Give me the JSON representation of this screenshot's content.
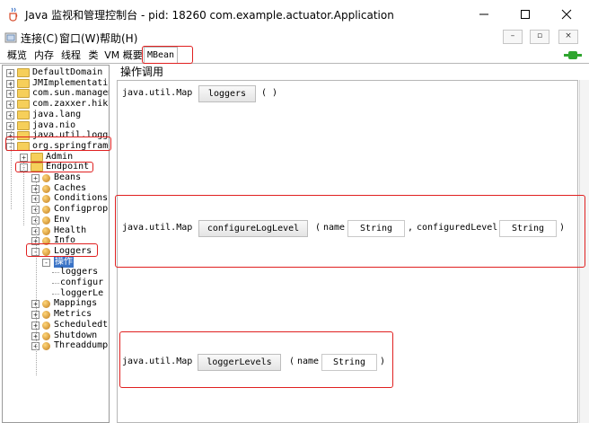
{
  "window": {
    "title": "Java 监视和管理控制台 - pid: 18260 com.example.actuator.Application",
    "minimize_glyph": "–",
    "maximize_glyph": "□",
    "close_glyph": "✕"
  },
  "menubar": {
    "items": [
      "连接(C)",
      "窗口(W)",
      "帮助(H)"
    ],
    "inner_buttons": [
      "–",
      "▫",
      "×"
    ]
  },
  "tabs": {
    "items": [
      "概览",
      "内存",
      "线程",
      "类",
      "VM 概要",
      "MBean"
    ],
    "active": "MBean"
  },
  "tree": {
    "rows": [
      {
        "label": "DefaultDomain",
        "level": 0,
        "kind": "folder",
        "expander": "+"
      },
      {
        "label": "JMImplementatio",
        "level": 0,
        "kind": "folder",
        "expander": "+"
      },
      {
        "label": "com.sun.managem",
        "level": 0,
        "kind": "folder",
        "expander": "+"
      },
      {
        "label": "com.zaxxer.hika",
        "level": 0,
        "kind": "folder",
        "expander": "+"
      },
      {
        "label": "java.lang",
        "level": 0,
        "kind": "folder",
        "expander": "+"
      },
      {
        "label": "java.nio",
        "level": 0,
        "kind": "folder",
        "expander": "+"
      },
      {
        "label": "java.util.loggi",
        "level": 0,
        "kind": "folder",
        "expander": "+"
      },
      {
        "label": "org.springframe",
        "level": 0,
        "kind": "folder",
        "expander": "-"
      },
      {
        "label": "Admin",
        "level": 1,
        "kind": "folder",
        "expander": "+"
      },
      {
        "label": "Endpoint",
        "level": 1,
        "kind": "folder",
        "expander": "-"
      },
      {
        "label": "Beans",
        "level": 2,
        "kind": "bean",
        "expander": "+"
      },
      {
        "label": "Caches",
        "level": 2,
        "kind": "bean",
        "expander": "+"
      },
      {
        "label": "Conditions",
        "level": 2,
        "kind": "bean",
        "expander": "+"
      },
      {
        "label": "Configprop",
        "level": 2,
        "kind": "bean",
        "expander": "+"
      },
      {
        "label": "Env",
        "level": 2,
        "kind": "bean",
        "expander": "+"
      },
      {
        "label": "Health",
        "level": 2,
        "kind": "bean",
        "expander": "+"
      },
      {
        "label": "Info",
        "level": 2,
        "kind": "bean",
        "expander": "+"
      },
      {
        "label": "Loggers",
        "level": 2,
        "kind": "bean",
        "expander": "-"
      },
      {
        "label": "操作",
        "level": 3,
        "kind": "category",
        "expander": "-",
        "selected": true
      },
      {
        "label": "loggers",
        "level": 4,
        "kind": "leaf"
      },
      {
        "label": "configur",
        "level": 4,
        "kind": "leaf"
      },
      {
        "label": "loggerLe",
        "level": 4,
        "kind": "leaf"
      },
      {
        "label": "Mappings",
        "level": 2,
        "kind": "bean",
        "expander": "+"
      },
      {
        "label": "Metrics",
        "level": 2,
        "kind": "bean",
        "expander": "+"
      },
      {
        "label": "Scheduledt",
        "level": 2,
        "kind": "bean",
        "expander": "+"
      },
      {
        "label": "Shutdown",
        "level": 2,
        "kind": "bean",
        "expander": "+"
      },
      {
        "label": "Threaddump",
        "level": 2,
        "kind": "bean",
        "expander": "+"
      }
    ]
  },
  "operations": {
    "header": "操作调用",
    "items": [
      {
        "return_type": "java.util.Map",
        "name": "loggers",
        "open_paren": "(",
        "close_paren": ")",
        "params": []
      },
      {
        "return_type": "java.util.Map",
        "name": "configureLogLevel",
        "open_paren": "(",
        "close_paren": ")",
        "params": [
          {
            "name": "name",
            "value": "String",
            "separator": ","
          },
          {
            "name": "configuredLevel",
            "value": "String",
            "separator": ""
          }
        ]
      },
      {
        "return_type": "java.util.Map",
        "name": "loggerLevels",
        "open_paren": "(",
        "close_paren": ")",
        "params": [
          {
            "name": "name",
            "value": "String",
            "separator": ""
          }
        ]
      }
    ]
  },
  "colors": {
    "highlight": "#e02020",
    "selection": "#3a73c6",
    "folder": "#f6cf5a",
    "connected": "#2fa52f"
  }
}
